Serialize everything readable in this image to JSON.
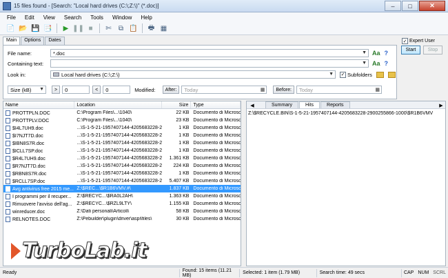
{
  "window": {
    "title": "15 files found - [Search: \"Local hard drives (C:\\;Z:\\)\" (*.doc)]"
  },
  "menu": [
    "File",
    "Edit",
    "View",
    "Search",
    "Tools",
    "Window",
    "Help"
  ],
  "search": {
    "tabs": [
      "Main",
      "Options",
      "Dates"
    ],
    "file_name_label": "File name:",
    "file_name_value": "*.doc",
    "containing_text_label": "Containing text:",
    "containing_text_value": "",
    "look_in_label": "Look in:",
    "look_in_value": "Local hard drives (C:\\;Z:\\)",
    "subfolders_label": "Subfolders",
    "size_filter": "Size (kB)",
    "size_op1": ">",
    "size_val1": "0",
    "size_op2": "<",
    "size_val2": "0",
    "modified_label": "Modified:",
    "after_label": "After:",
    "after_value": "Today",
    "before_label": "Before:",
    "before_value": "Today",
    "aa_label": "Aa",
    "help_label": "?"
  },
  "actions": {
    "expert_user_label": "Expert User",
    "start_label": "Start",
    "stop_label": "Stop"
  },
  "results": {
    "columns": [
      "Name",
      "Location",
      "Size",
      "Type"
    ],
    "rows": [
      {
        "name": "PROTTPLN.DOC",
        "location": "C:\\Program Files\\...\\1040\\",
        "size": "22 KB",
        "type": "Documento di Microso"
      },
      {
        "name": "PROTTPLV.DOC",
        "location": "C:\\Program Files\\...\\1040\\",
        "size": "23 KB",
        "type": "Documento di Microso"
      },
      {
        "name": "$I4L7UH9.doc",
        "location": "...\\S-1-5-21-1957407144-4205683228-2",
        "size": "1 KB",
        "type": "Documento di Microso"
      },
      {
        "name": "$I7NJT7D.doc",
        "location": "...\\S-1-5-21-1957407144-4205683228-2",
        "size": "1 KB",
        "type": "Documento di Microso"
      },
      {
        "name": "$IBN8S7R.doc",
        "location": "...\\S-1-5-21-1957407144-4205683228-2",
        "size": "1 KB",
        "type": "Documento di Microso"
      },
      {
        "name": "$ICLL7SP.doc",
        "location": "...\\S-1-5-21-1957407144-4205683228-2",
        "size": "1 KB",
        "type": "Documento di Microso"
      },
      {
        "name": "$R4L7UH9.doc",
        "location": "...\\S-1-5-21-1957407144-4205683228-2",
        "size": "1.361 KB",
        "type": "Documento di Microso"
      },
      {
        "name": "$R7NJT7D.doc",
        "location": "...\\S-1-5-21-1957407144-4205683228-2",
        "size": "224 KB",
        "type": "Documento di Microso"
      },
      {
        "name": "$RBN8S7R.doc",
        "location": "...\\S-1-5-21-1957407144-4205683228-2",
        "size": "1 KB",
        "type": "Documento di Microso"
      },
      {
        "name": "$RCLL7SP.doc",
        "location": "...\\S-1-5-21-1957407144-4205683228-2",
        "size": "5.407 KB",
        "type": "Documento di Microso"
      },
      {
        "name": "Avg antivirus free 2015 me...",
        "location": "Z:\\$REC...\\$R1B6VMV.#\\",
        "size": "1.837 KB",
        "type": "Documento di Microso"
      },
      {
        "name": "I programmi per il recuper...",
        "location": "Z:\\$RECYC...\\$RA0L2AH\\",
        "size": "1.363 KB",
        "type": "Documento di Microso"
      },
      {
        "name": "Rimuovere l'avviso dell'ag...",
        "location": "Z:\\$RECYC...\\$RZL9LTY\\",
        "size": "1.155 KB",
        "type": "Documento di Microso"
      },
      {
        "name": "winreducer.doc",
        "location": "Z:\\Dati personali\\Articoli\\",
        "size": "58 KB",
        "type": "Documento di Microso"
      },
      {
        "name": "RELNOTES.DOC",
        "location": "Z:\\Pebuilder\\plugin\\driver\\aspi\\files\\",
        "size": "30 KB",
        "type": "Documento di Microso"
      }
    ]
  },
  "preview": {
    "tabs": [
      "Summary",
      "Hits",
      "Reports"
    ],
    "content": "Z:\\$RECYCLE.BIN\\S-1-5-21-1957407144-4205683228-2900255866-1000\\$R1B6VMV"
  },
  "status": {
    "ready": "Ready",
    "found": "Found: 15 items (11.21 MB)",
    "selected": "Selected: 1 item (1.79 MB)",
    "time": "Search time: 49 secs",
    "caps": "CAP",
    "num": "NUM",
    "scrl": "SCRL"
  },
  "watermark": {
    "text": "TurboLab.it"
  }
}
